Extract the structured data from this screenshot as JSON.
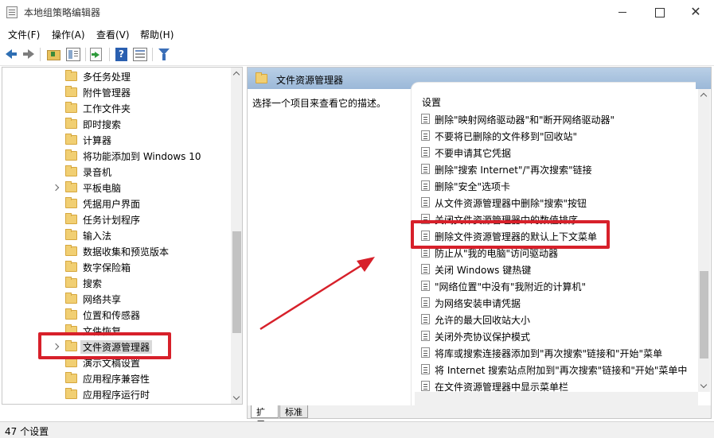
{
  "window": {
    "title": "本地组策略编辑器"
  },
  "menu": [
    "文件(F)",
    "操作(A)",
    "查看(V)",
    "帮助(H)"
  ],
  "toolbar": {
    "help_glyph": "?"
  },
  "tree": {
    "items": [
      {
        "label": "多任务处理",
        "chevron": false
      },
      {
        "label": "附件管理器",
        "chevron": false
      },
      {
        "label": "工作文件夹",
        "chevron": false
      },
      {
        "label": "即时搜索",
        "chevron": false
      },
      {
        "label": "计算器",
        "chevron": false
      },
      {
        "label": "将功能添加到 Windows 10",
        "chevron": false
      },
      {
        "label": "录音机",
        "chevron": false
      },
      {
        "label": "平板电脑",
        "chevron": true
      },
      {
        "label": "凭据用户界面",
        "chevron": false
      },
      {
        "label": "任务计划程序",
        "chevron": false
      },
      {
        "label": "输入法",
        "chevron": false
      },
      {
        "label": "数据收集和预览版本",
        "chevron": false
      },
      {
        "label": "数字保险箱",
        "chevron": false
      },
      {
        "label": "搜索",
        "chevron": false
      },
      {
        "label": "网络共享",
        "chevron": false
      },
      {
        "label": "位置和传感器",
        "chevron": false
      },
      {
        "label": "文件恢复",
        "chevron": false
      },
      {
        "label": "文件资源管理器",
        "chevron": true,
        "selected": true
      },
      {
        "label": "演示文稿设置",
        "chevron": false
      },
      {
        "label": "应用程序兼容性",
        "chevron": false
      },
      {
        "label": "应用程序运行时",
        "chevron": false
      }
    ]
  },
  "right": {
    "title": "文件资源管理器",
    "description": "选择一个项目来查看它的描述。",
    "list_header": "设置",
    "settings": [
      "删除\"映射网络驱动器\"和\"断开网络驱动器\"",
      "不要将已删除的文件移到\"回收站\"",
      "不要申请其它凭据",
      "删除\"搜索 Internet\"/\"再次搜索\"链接",
      "删除\"安全\"选项卡",
      "从文件资源管理器中删除\"搜索\"按钮",
      "关闭文件资源管理器中的数值排序",
      "删除文件资源管理器的默认上下文菜单",
      "防止从\"我的电脑\"访问驱动器",
      "关闭 Windows 键热键",
      "\"网络位置\"中没有\"我附近的计算机\"",
      "为网络安装申请凭据",
      "允许的最大回收站大小",
      "关闭外壳协议保护模式",
      "将库或搜索连接器添加到\"再次搜索\"链接和\"开始\"菜单",
      "将 Internet 搜索站点附加到\"再次搜索\"链接和\"开始\"菜单中",
      "在文件资源管理器中显示菜单栏"
    ]
  },
  "tabs": [
    "扩展",
    "标准"
  ],
  "status": {
    "text": "47 个设置"
  },
  "colors": {
    "annotation_red": "#d7202a",
    "header_blue": "#a9c3e0"
  }
}
